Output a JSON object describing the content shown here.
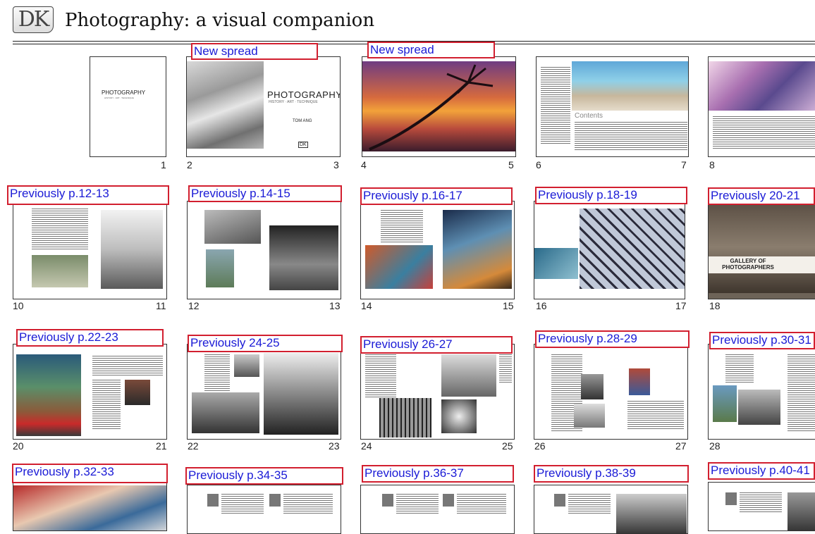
{
  "header": {
    "logo_text": "DK",
    "title": "Photography: a visual companion"
  },
  "cover": {
    "title": "PHOTOGRAPHY",
    "subtitle": "HISTORY · ART · TECHNIQUE",
    "author": "TOM ANG",
    "imprint": "DK"
  },
  "contents_heading": "Contents",
  "gallery_title": "GALLERY OF PHOTOGRAPHERS",
  "labels": [
    "New spread",
    "New spread",
    "Previously p.12-13",
    "Previously p.14-15",
    "Previously p.16-17",
    "Previously p.18-19",
    "Previously 20-21",
    "Previously p.22-23",
    "Previously 24-25",
    "Previously 26-27",
    "Previously p.28-29",
    "Previously p.30-31",
    "Previously p.32-33",
    "Previously p.34-35",
    "Previously p.36-37",
    "Previously p.38-39",
    "Previously p.40-41"
  ],
  "page_numbers": [
    "1",
    "2",
    "3",
    "4",
    "5",
    "6",
    "7",
    "8",
    "10",
    "11",
    "12",
    "13",
    "14",
    "15",
    "16",
    "17",
    "18",
    "20",
    "21",
    "22",
    "23",
    "24",
    "25",
    "26",
    "27",
    "28"
  ]
}
